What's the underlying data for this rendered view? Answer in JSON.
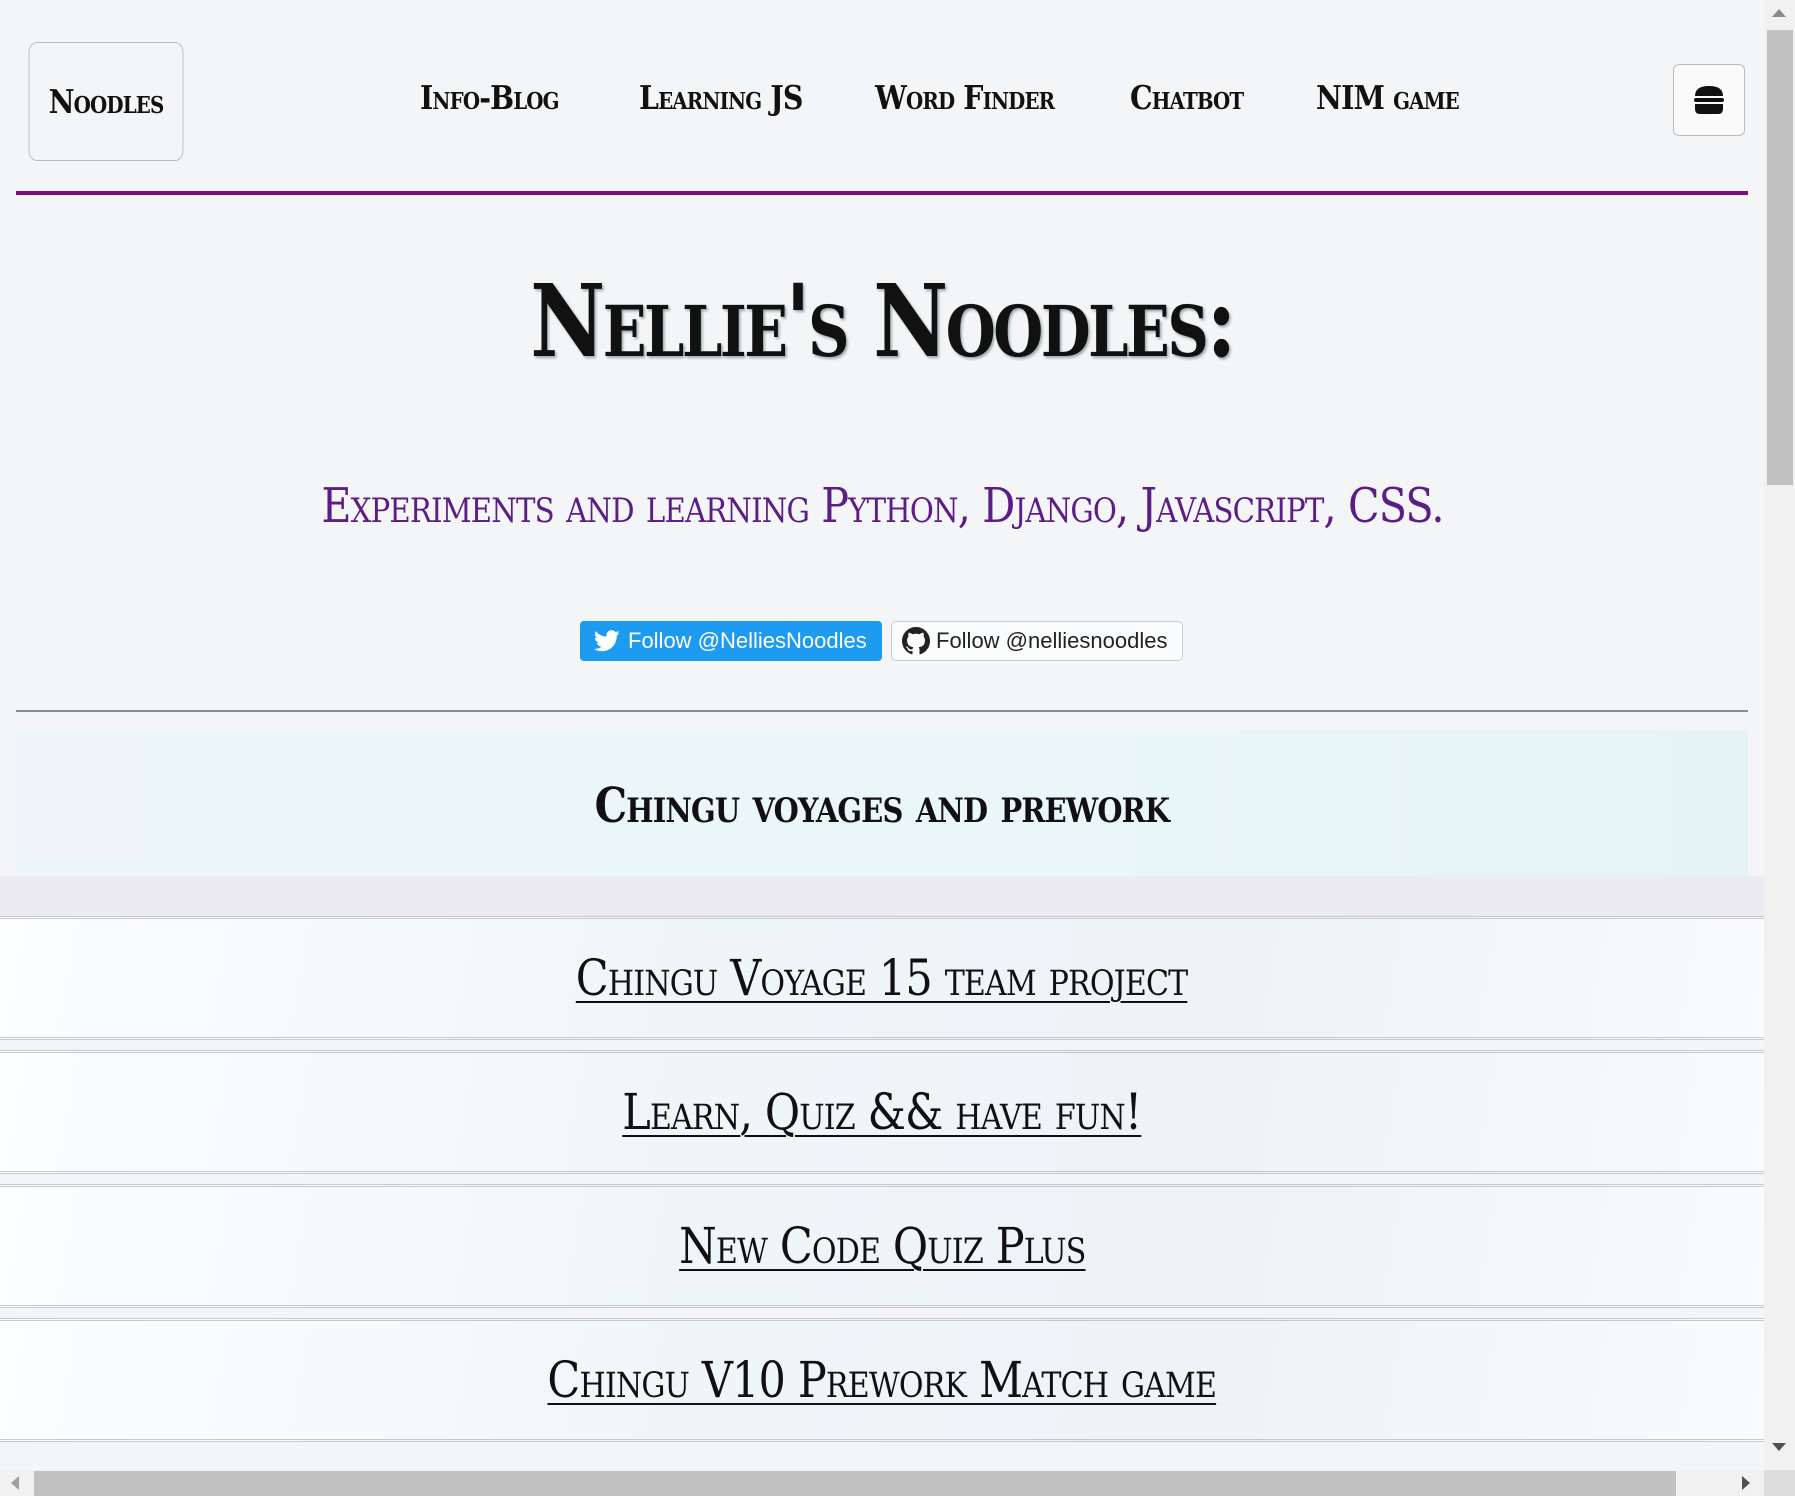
{
  "nav": {
    "brand": "Noodles",
    "links": [
      "Info-Blog",
      "Learning JS",
      "Word Finder",
      "Chatbot",
      "NIM game"
    ],
    "menu_icon": "burger-icon"
  },
  "hero": {
    "title": "Nellie's Noodles:",
    "subtitle": "Experiments and learning Python, Django, Javascript, CSS."
  },
  "social": {
    "twitter_label": "Follow @NelliesNoodles",
    "github_label": "Follow @nelliesnoodles",
    "twitter_color": "#1d9bf0"
  },
  "section": {
    "title": "Chingu voyages and prework",
    "items": [
      "Chingu Voyage 15 team project",
      "Learn, Quiz && have fun!",
      "New Code Quiz Plus",
      "Chingu V10 Prework Match game"
    ]
  },
  "colors": {
    "accent_rule": "#7a0f78",
    "subtitle": "#5b1d86"
  }
}
